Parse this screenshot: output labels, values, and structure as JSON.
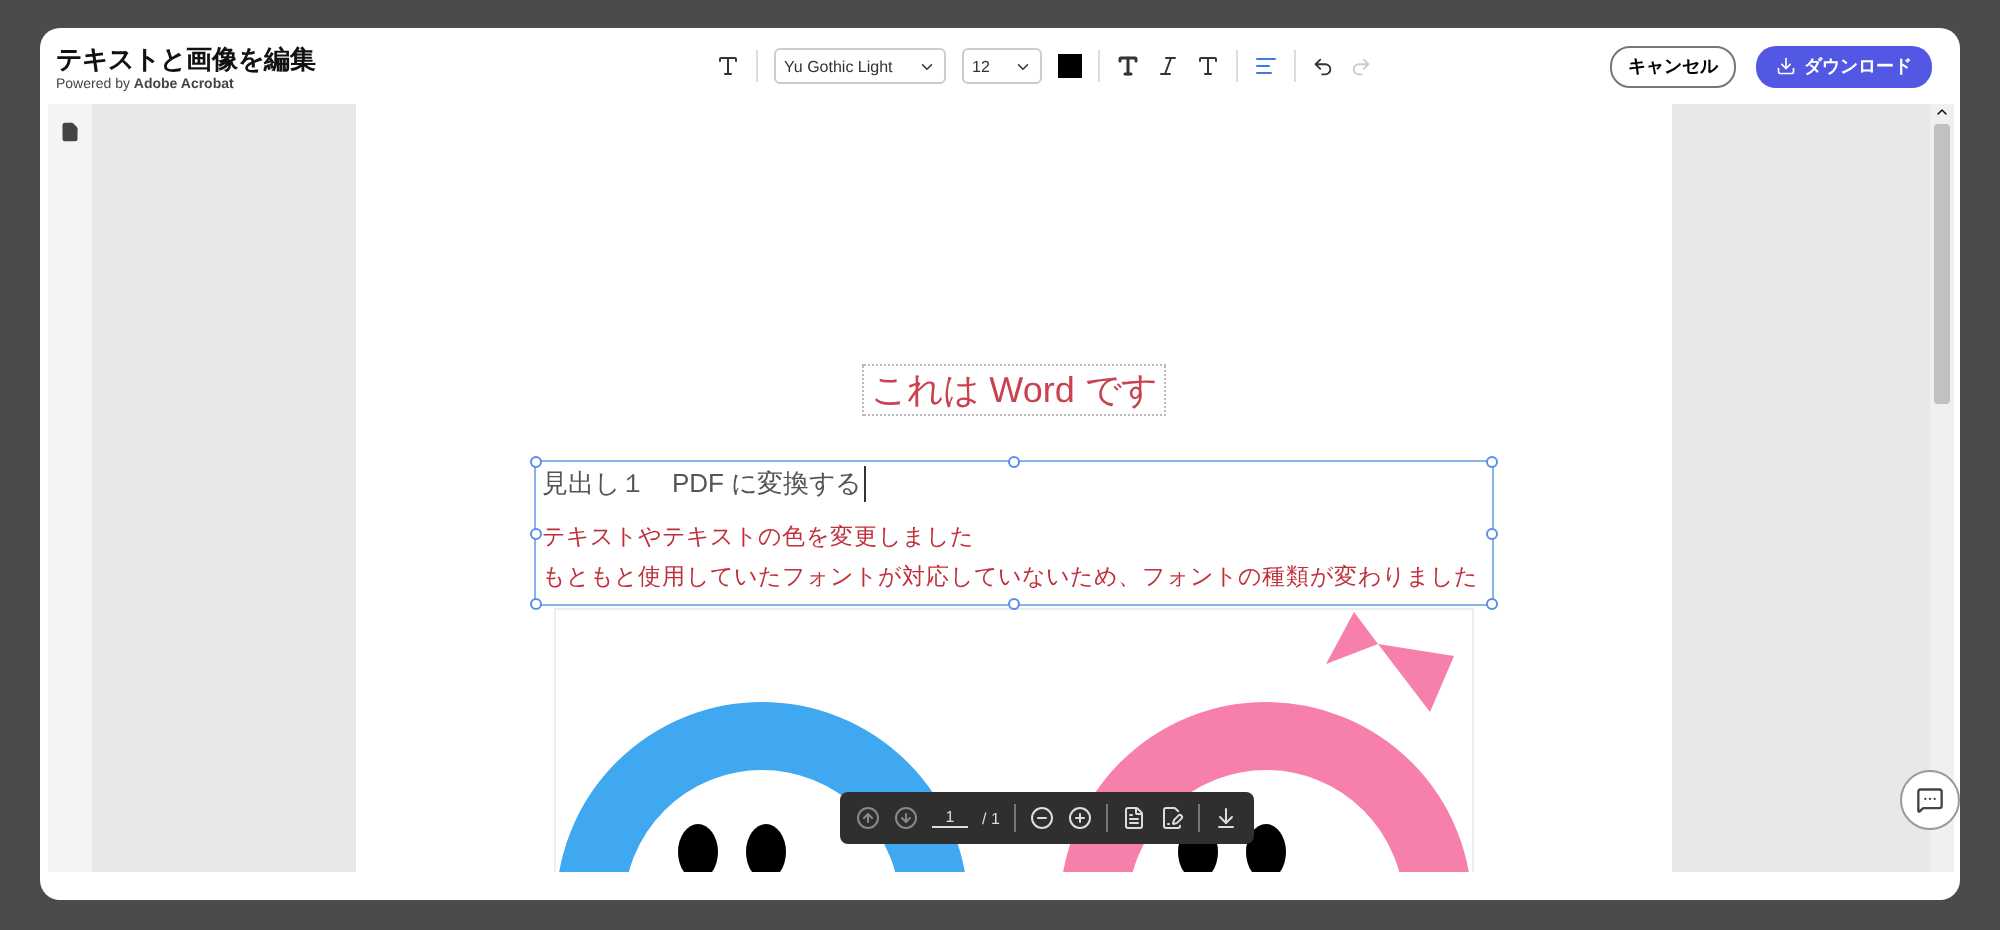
{
  "dialog": {
    "title": "テキストと画像を編集",
    "subtitle_prefix": "Powered by ",
    "subtitle_brand": "Adobe Acrobat"
  },
  "toolbar": {
    "font": "Yu Gothic Light",
    "size": "12",
    "undo_disabled": false,
    "redo_disabled": true
  },
  "actions": {
    "cancel": "キャンセル",
    "download": "ダウンロード"
  },
  "document": {
    "title": "これは Word です",
    "heading": "見出し１　PDF に変換する",
    "lines": [
      "テキストやテキストの色を変更しました",
      "もともと使用していたフォントが対応していないため、フォントの種類が変わりました"
    ]
  },
  "page_nav": {
    "current": "1",
    "total": "/ 1"
  }
}
